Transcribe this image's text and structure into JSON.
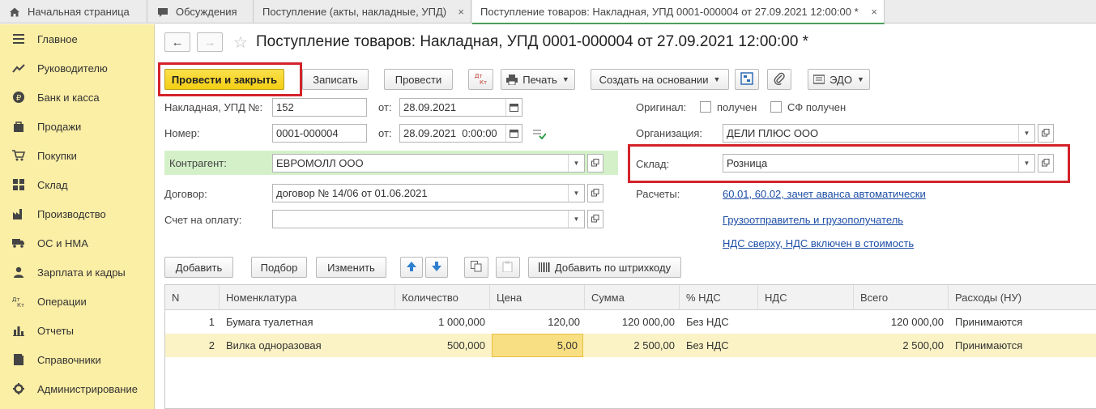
{
  "tabs": [
    {
      "label": "Начальная страница",
      "icon": "home-icon"
    },
    {
      "label": "Обсуждения",
      "icon": "chat-icon"
    },
    {
      "label": "Поступление (акты, накладные, УПД)",
      "icon": ""
    },
    {
      "label": "Поступление товаров: Накладная, УПД 0001-000004 от 27.09.2021 12:00:00 *",
      "icon": ""
    }
  ],
  "tab_close": "×",
  "sidebar": {
    "items": [
      {
        "label": "Главное",
        "icon": "menu-icon"
      },
      {
        "label": "Руководителю",
        "icon": "trend-icon"
      },
      {
        "label": "Банк и касса",
        "icon": "ruble-icon"
      },
      {
        "label": "Продажи",
        "icon": "bag-icon"
      },
      {
        "label": "Покупки",
        "icon": "cart-icon"
      },
      {
        "label": "Склад",
        "icon": "grid-icon"
      },
      {
        "label": "Производство",
        "icon": "factory-icon"
      },
      {
        "label": "ОС и НМА",
        "icon": "truck-icon"
      },
      {
        "label": "Зарплата и кадры",
        "icon": "person-icon"
      },
      {
        "label": "Операции",
        "icon": "dtkt-icon"
      },
      {
        "label": "Отчеты",
        "icon": "bar-chart-icon"
      },
      {
        "label": "Справочники",
        "icon": "book-icon"
      },
      {
        "label": "Администрирование",
        "icon": "gear-icon"
      }
    ]
  },
  "document": {
    "title": "Поступление товаров: Накладная, УПД 0001-000004 от 27.09.2021 12:00:00 *",
    "nav_back": "←",
    "nav_forward": "→"
  },
  "toolbar": {
    "post_close": "Провести и закрыть",
    "save": "Записать",
    "post": "Провести",
    "dtkt": "Дт Кт",
    "print": "Печать",
    "create_based": "Создать на основании",
    "edo": "ЭДО"
  },
  "form": {
    "invoice_label": "Накладная, УПД №:",
    "invoice_value": "152",
    "from_label": "от:",
    "invoice_date": "28.09.2021",
    "number_label": "Номер:",
    "number_value": "0001-000004",
    "number_date": "28.09.2021  0:00:00",
    "counterparty_label": "Контрагент:",
    "counterparty_value": "ЕВРОМОЛЛ ООО",
    "contract_label": "Договор:",
    "contract_value": "договор № 14/06 от 01.06.2021",
    "payment_label": "Счет на оплату:",
    "payment_value": "",
    "original_label": "Оригинал:",
    "received_label": "получен",
    "sf_received_label": "СФ получен",
    "org_label": "Организация:",
    "org_value": "ДЕЛИ ПЛЮС ООО",
    "warehouse_label": "Склад:",
    "warehouse_value": "Розница",
    "settlements_label": "Расчеты:",
    "settlements_link": "60.01, 60.02, зачет аванса автоматически",
    "shipper_link": "Грузоотправитель и грузополучатель",
    "vat_link": "НДС сверху, НДС включен в стоимость"
  },
  "table_toolbar": {
    "add": "Добавить",
    "pick": "Подбор",
    "edit": "Изменить",
    "barcode": "Добавить по штрихкоду"
  },
  "table": {
    "headers": [
      "N",
      "Номенклатура",
      "Количество",
      "Цена",
      "Сумма",
      "% НДС",
      "НДС",
      "Всего",
      "Расходы (НУ)"
    ],
    "rows": [
      [
        "1",
        "Бумага туалетная",
        "1 000,000",
        "120,00",
        "120 000,00",
        "Без НДС",
        "",
        "120 000,00",
        "Принимаются"
      ],
      [
        "2",
        "Вилка одноразовая",
        "500,000",
        "5,00",
        "2 500,00",
        "Без НДС",
        "",
        "2 500,00",
        "Принимаются"
      ]
    ]
  },
  "colors": {
    "sidebar_bg": "#fbeea5",
    "primary_button": "#f3cf14",
    "highlight_box": "#d3232a",
    "link": "#1e4fa6",
    "counterparty_bg": "#d4f0c9",
    "selected_row": "#fbf3c5"
  }
}
